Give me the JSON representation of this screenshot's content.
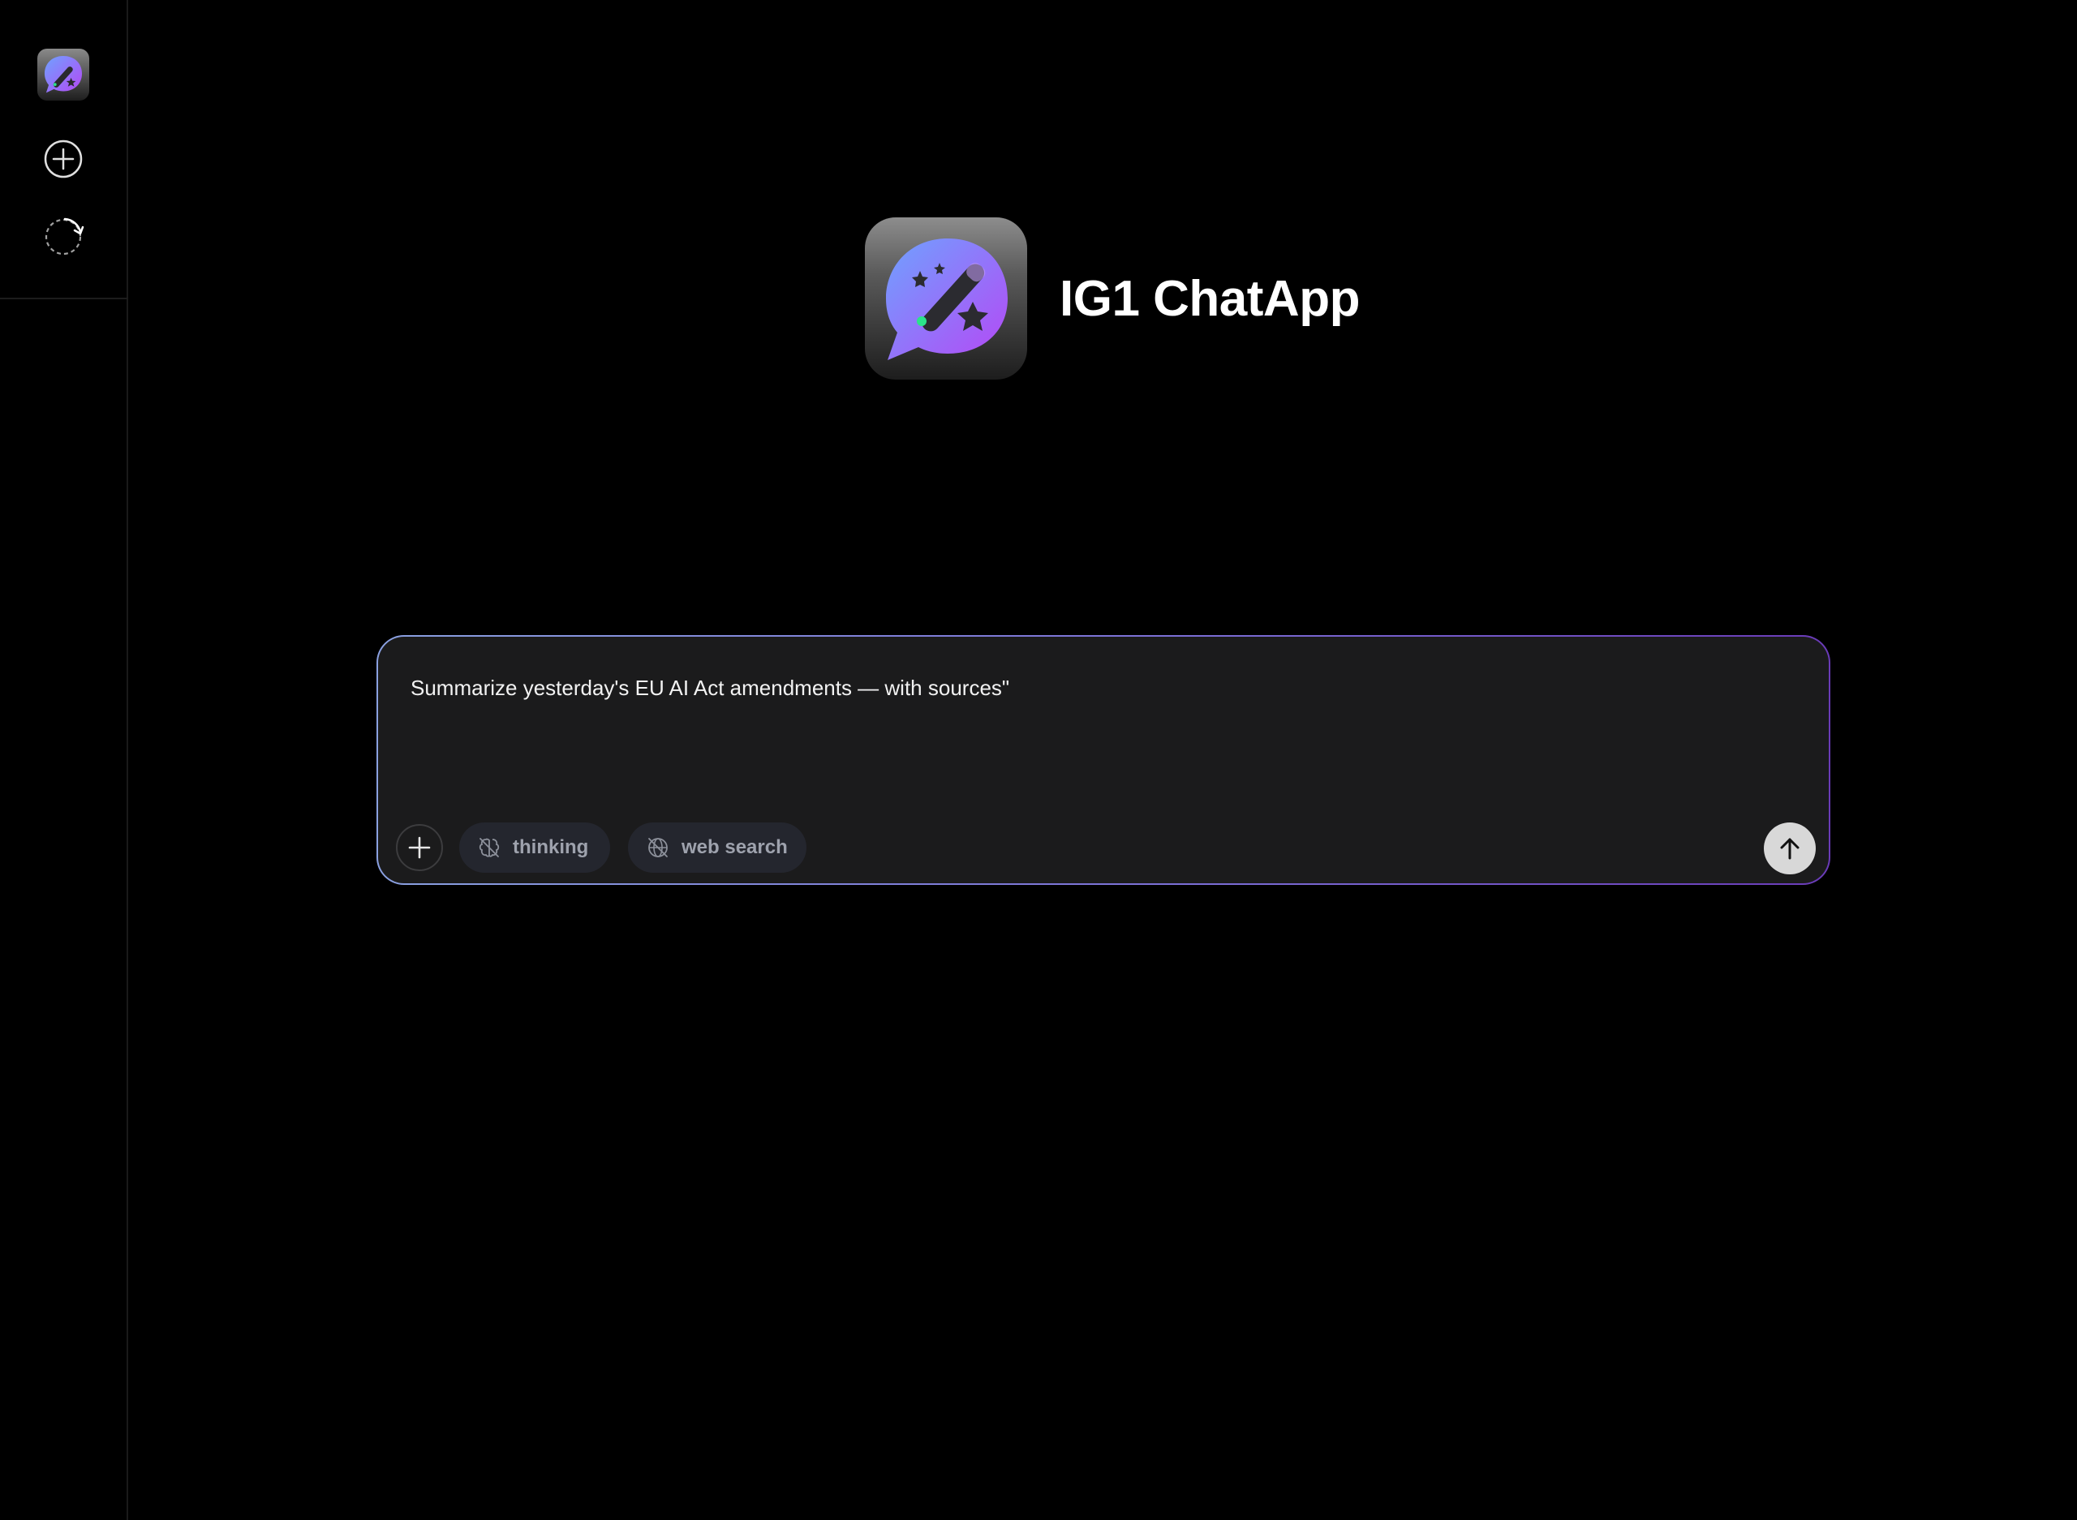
{
  "app": {
    "title": "IG1 ChatApp"
  },
  "sidebar": {
    "items": [
      {
        "icon": "app-logo-icon"
      },
      {
        "icon": "plus-circle-icon",
        "action": "new-chat"
      },
      {
        "icon": "dashed-circle-arrow-icon",
        "action": "history"
      }
    ]
  },
  "composer": {
    "value": "Summarize yesterday's EU AI Act amendments — with sources\"",
    "attach_icon": "plus-icon",
    "toggles": [
      {
        "label": "thinking",
        "icon": "brain-off-icon",
        "enabled": false
      },
      {
        "label": "web search",
        "icon": "globe-off-icon",
        "enabled": false
      }
    ],
    "send_icon": "arrow-up-icon"
  },
  "colors": {
    "background": "#000000",
    "composer_bg": "#1b1b1c",
    "border_gradient_start": "#8aa0e0",
    "border_gradient_end": "#6a3bb8",
    "logo_bubble_start": "#6fa2ff",
    "logo_bubble_end": "#b548f5",
    "pill_bg": "#24262e",
    "send_bg": "#d8d8d8"
  }
}
